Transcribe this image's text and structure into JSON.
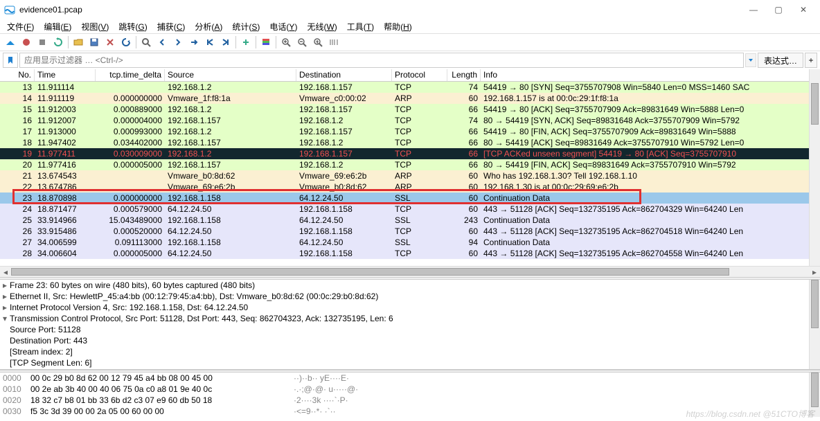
{
  "title": "evidence01.pcap",
  "menu": [
    "文件(F)",
    "编辑(E)",
    "视图(V)",
    "跳转(G)",
    "捕获(C)",
    "分析(A)",
    "统计(S)",
    "电话(Y)",
    "无线(W)",
    "工具(T)",
    "帮助(H)"
  ],
  "filter_placeholder": "应用显示过滤器 … <Ctrl-/>",
  "expr_label": "表达式…",
  "columns": [
    "No.",
    "Time",
    "tcp.time_delta",
    "Source",
    "Destination",
    "Protocol",
    "Length",
    "Info"
  ],
  "rows": [
    {
      "no": "13",
      "time": "11.911114",
      "delta": "",
      "src": "192.168.1.2",
      "dst": "192.168.1.157",
      "proto": "TCP",
      "len": "74",
      "info": "54419 → 80 [SYN] Seq=3755707908 Win=5840 Len=0 MSS=1460 SAC",
      "bg": "#e4ffc7",
      "fg": "#000"
    },
    {
      "no": "14",
      "time": "11.911119",
      "delta": "0.000000000",
      "src": "Vmware_1f:f8:1a",
      "dst": "Vmware_c0:00:02",
      "proto": "ARP",
      "len": "60",
      "info": "192.168.1.157 is at 00:0c:29:1f:f8:1a",
      "bg": "#fbf0d2",
      "fg": "#000"
    },
    {
      "no": "15",
      "time": "11.912003",
      "delta": "0.000889000",
      "src": "192.168.1.2",
      "dst": "192.168.1.157",
      "proto": "TCP",
      "len": "66",
      "info": "54419 → 80 [ACK] Seq=3755707909 Ack=89831649 Win=5888 Len=0",
      "bg": "#e4ffc7",
      "fg": "#000"
    },
    {
      "no": "16",
      "time": "11.912007",
      "delta": "0.000004000",
      "src": "192.168.1.157",
      "dst": "192.168.1.2",
      "proto": "TCP",
      "len": "74",
      "info": "80 → 54419 [SYN, ACK] Seq=89831648 Ack=3755707909 Win=5792",
      "bg": "#e4ffc7",
      "fg": "#000"
    },
    {
      "no": "17",
      "time": "11.913000",
      "delta": "0.000993000",
      "src": "192.168.1.2",
      "dst": "192.168.1.157",
      "proto": "TCP",
      "len": "66",
      "info": "54419 → 80 [FIN, ACK] Seq=3755707909 Ack=89831649 Win=5888",
      "bg": "#e4ffc7",
      "fg": "#000"
    },
    {
      "no": "18",
      "time": "11.947402",
      "delta": "0.034402000",
      "src": "192.168.1.157",
      "dst": "192.168.1.2",
      "proto": "TCP",
      "len": "66",
      "info": "80 → 54419 [ACK] Seq=89831649 Ack=3755707910 Win=5792 Len=0",
      "bg": "#e4ffc7",
      "fg": "#000"
    },
    {
      "no": "19",
      "time": "11.977411",
      "delta": "0.030009000",
      "src": "192.168.1.2",
      "dst": "192.168.1.157",
      "proto": "TCP",
      "len": "66",
      "info": "[TCP ACKed unseen segment] 54419 → 80 [ACK] Seq=3755707910",
      "bg": "#12272e",
      "fg": "#f05050"
    },
    {
      "no": "20",
      "time": "11.977416",
      "delta": "0.000005000",
      "src": "192.168.1.157",
      "dst": "192.168.1.2",
      "proto": "TCP",
      "len": "66",
      "info": "80 → 54419 [FIN, ACK] Seq=89831649 Ack=3755707910 Win=5792",
      "bg": "#e4ffc7",
      "fg": "#000"
    },
    {
      "no": "21",
      "time": "13.674543",
      "delta": "",
      "src": "Vmware_b0:8d:62",
      "dst": "Vmware_69:e6:2b",
      "proto": "ARP",
      "len": "60",
      "info": "Who has 192.168.1.30? Tell 192.168.1.10",
      "bg": "#fbf0d2",
      "fg": "#000"
    },
    {
      "no": "22",
      "time": "13.674786",
      "delta": "",
      "src": "Vmware_69:e6:2b",
      "dst": "Vmware_b0:8d:62",
      "proto": "ARP",
      "len": "60",
      "info": "192.168.1.30 is at 00:0c:29:69:e6:2b",
      "bg": "#fbf0d2",
      "fg": "#000"
    },
    {
      "no": "23",
      "time": "18.870898",
      "delta": "0.000000000",
      "src": "192.168.1.158",
      "dst": "64.12.24.50",
      "proto": "SSL",
      "len": "60",
      "info": "Continuation Data",
      "bg": "#9bc8ea",
      "fg": "#000",
      "selected": true
    },
    {
      "no": "24",
      "time": "18.871477",
      "delta": "0.000579000",
      "src": "64.12.24.50",
      "dst": "192.168.1.158",
      "proto": "TCP",
      "len": "60",
      "info": "443 → 51128 [ACK] Seq=132735195 Ack=862704329 Win=64240 Len",
      "bg": "#e6e6fa",
      "fg": "#000"
    },
    {
      "no": "25",
      "time": "33.914966",
      "delta": "15.043489000",
      "src": "192.168.1.158",
      "dst": "64.12.24.50",
      "proto": "SSL",
      "len": "243",
      "info": "Continuation Data",
      "bg": "#e6e6fa",
      "fg": "#000"
    },
    {
      "no": "26",
      "time": "33.915486",
      "delta": "0.000520000",
      "src": "64.12.24.50",
      "dst": "192.168.1.158",
      "proto": "TCP",
      "len": "60",
      "info": "443 → 51128 [ACK] Seq=132735195 Ack=862704518 Win=64240 Len",
      "bg": "#e6e6fa",
      "fg": "#000"
    },
    {
      "no": "27",
      "time": "34.006599",
      "delta": "0.091113000",
      "src": "192.168.1.158",
      "dst": "64.12.24.50",
      "proto": "SSL",
      "len": "94",
      "info": "Continuation Data",
      "bg": "#e6e6fa",
      "fg": "#000"
    },
    {
      "no": "28",
      "time": "34.006604",
      "delta": "0.000005000",
      "src": "64.12.24.50",
      "dst": "192.168.1.158",
      "proto": "TCP",
      "len": "60",
      "info": "443 → 51128 [ACK] Seq=132735195 Ack=862704558 Win=64240 Len",
      "bg": "#e6e6fa",
      "fg": "#000"
    }
  ],
  "details": [
    {
      "exp": "▸",
      "text": "Frame 23: 60 bytes on wire (480 bits), 60 bytes captured (480 bits)"
    },
    {
      "exp": "▸",
      "text": "Ethernet II, Src: HewlettP_45:a4:bb (00:12:79:45:a4:bb), Dst: Vmware_b0:8d:62 (00:0c:29:b0:8d:62)"
    },
    {
      "exp": "▸",
      "text": "Internet Protocol Version 4, Src: 192.168.1.158, Dst: 64.12.24.50"
    },
    {
      "exp": "▾",
      "text": "Transmission Control Protocol, Src Port: 51128, Dst Port: 443, Seq: 862704323, Ack: 132735195, Len: 6"
    },
    {
      "exp": "",
      "text": "   Source Port: 51128"
    },
    {
      "exp": "",
      "text": "   Destination Port: 443"
    },
    {
      "exp": "",
      "text": "   [Stream index: 2]"
    },
    {
      "exp": "",
      "text": "   [TCP Segment Len: 6]"
    }
  ],
  "hex": [
    {
      "off": "0000",
      "h": "00 0c 29 b0 8d 62 00 12  79 45 a4 bb 08 00 45 00",
      "a": "··)··b·· yE····E·"
    },
    {
      "off": "0010",
      "h": "00 2e ab 3b 40 00 40 06  75 0a c0 a8 01 9e 40 0c",
      "a": "·.·;@·@· u·····@·"
    },
    {
      "off": "0020",
      "h": "18 32 c7 b8 01 bb 33 6b  d2 c3 07 e9 60 db 50 18",
      "a": "·2····3k ····`·P·"
    },
    {
      "off": "0030",
      "h": "f5 3c 3d 39 00 00 2a 05  00 60 00 00",
      "a": "·<=9··*· ·`··"
    }
  ],
  "watermark": "https://blog.csdn.net  @51CTO博客"
}
